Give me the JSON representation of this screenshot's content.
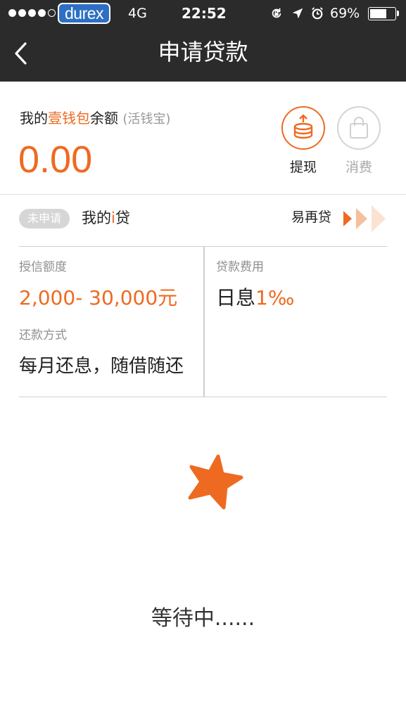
{
  "status_bar": {
    "carrier": "durex",
    "network": "4G",
    "time": "22:52",
    "battery_percent": "69%",
    "battery_level": 0.69,
    "icons": [
      "signal-dots",
      "rotation-lock-icon",
      "location-arrow-icon",
      "alarm-icon",
      "battery-icon"
    ]
  },
  "nav": {
    "back_icon": "chevron-left-icon",
    "title": "申请贷款"
  },
  "balance": {
    "label_prefix": "我的",
    "label_highlight": "壹钱包",
    "label_suffix": "余额",
    "label_sub": "(活钱宝)",
    "amount": "0.00",
    "actions": [
      {
        "label": "提现",
        "icon": "withdraw-coins-icon"
      },
      {
        "label": "消费",
        "icon": "shopping-bag-icon"
      }
    ]
  },
  "product": {
    "status_badge": "未申请",
    "name_prefix": "我的",
    "name_highlight": "i",
    "name_suffix": "贷",
    "promo_link": "易再贷",
    "promo_icon": "triple-arrow-icon"
  },
  "info": {
    "credit_label": "授信额度",
    "credit_value": "2,000- 30,000元",
    "fee_label": "贷款费用",
    "fee_prefix": "日息",
    "fee_rate": "1‰",
    "repay_label": "还款方式",
    "repay_value": "每月还息，随借随还"
  },
  "waiting": {
    "icon": "star-icon",
    "text": "等待中......"
  },
  "colors": {
    "accent": "#ee6a21",
    "header_bg": "#2b2b2b",
    "muted": "#8f8f8f",
    "badge_bg": "#d6d6d6"
  }
}
